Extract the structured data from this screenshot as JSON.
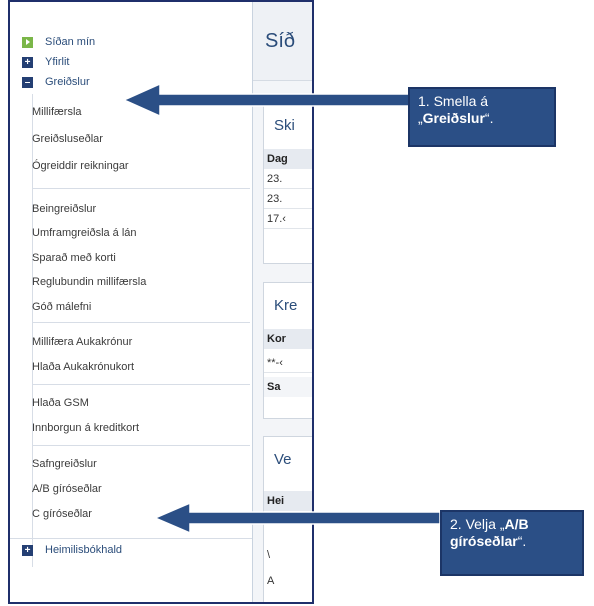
{
  "sidebar": {
    "top_items": [
      {
        "label": "Síðan mín",
        "icon": "play-icon"
      },
      {
        "label": "Yfirlit",
        "icon": "plus-icon"
      },
      {
        "label": "Greiðslur",
        "icon": "minus-icon"
      }
    ],
    "sub_items": [
      "Millifærsla",
      "Greiðsluseðlar",
      "Ógreiddir reikningar",
      "Beingreiðslur",
      "Umframgreiðsla á lán",
      "Sparað með korti",
      "Reglubundin millifærsla",
      "Góð málefni",
      "Millifæra Aukakrónur",
      "Hlaða Aukakrónukort",
      "Hlaða GSM",
      "Innborgun á kreditkort",
      "Safngreiðslur",
      "A/B gíróseðlar",
      "C gíróseðlar"
    ],
    "bottom_item": {
      "label": "Heimilisbókhald",
      "icon": "plus-icon"
    }
  },
  "content": {
    "title": "Síð",
    "panel1": {
      "title": "Ski",
      "head": "Dag",
      "rows": [
        "23.",
        "23.",
        "17.‹"
      ]
    },
    "panel2": {
      "title": "Kre",
      "head": "Kor",
      "rows": [
        "**-‹",
        "Sa"
      ]
    },
    "panel3": {
      "title": "Ve",
      "head": "Hei",
      "rows": [
        "\\",
        "A"
      ]
    }
  },
  "callouts": [
    {
      "prefix": "1. Smella á „",
      "bold": "Greiðslur",
      "suffix": "“."
    },
    {
      "prefix": "2. Velja „",
      "bold": "A/B gíróseðlar",
      "suffix": "“."
    }
  ],
  "colors": {
    "accent": "#2b4f86",
    "sidebar_text": "#2b4d7a",
    "green": "#7ab648",
    "navy": "#243f73"
  }
}
